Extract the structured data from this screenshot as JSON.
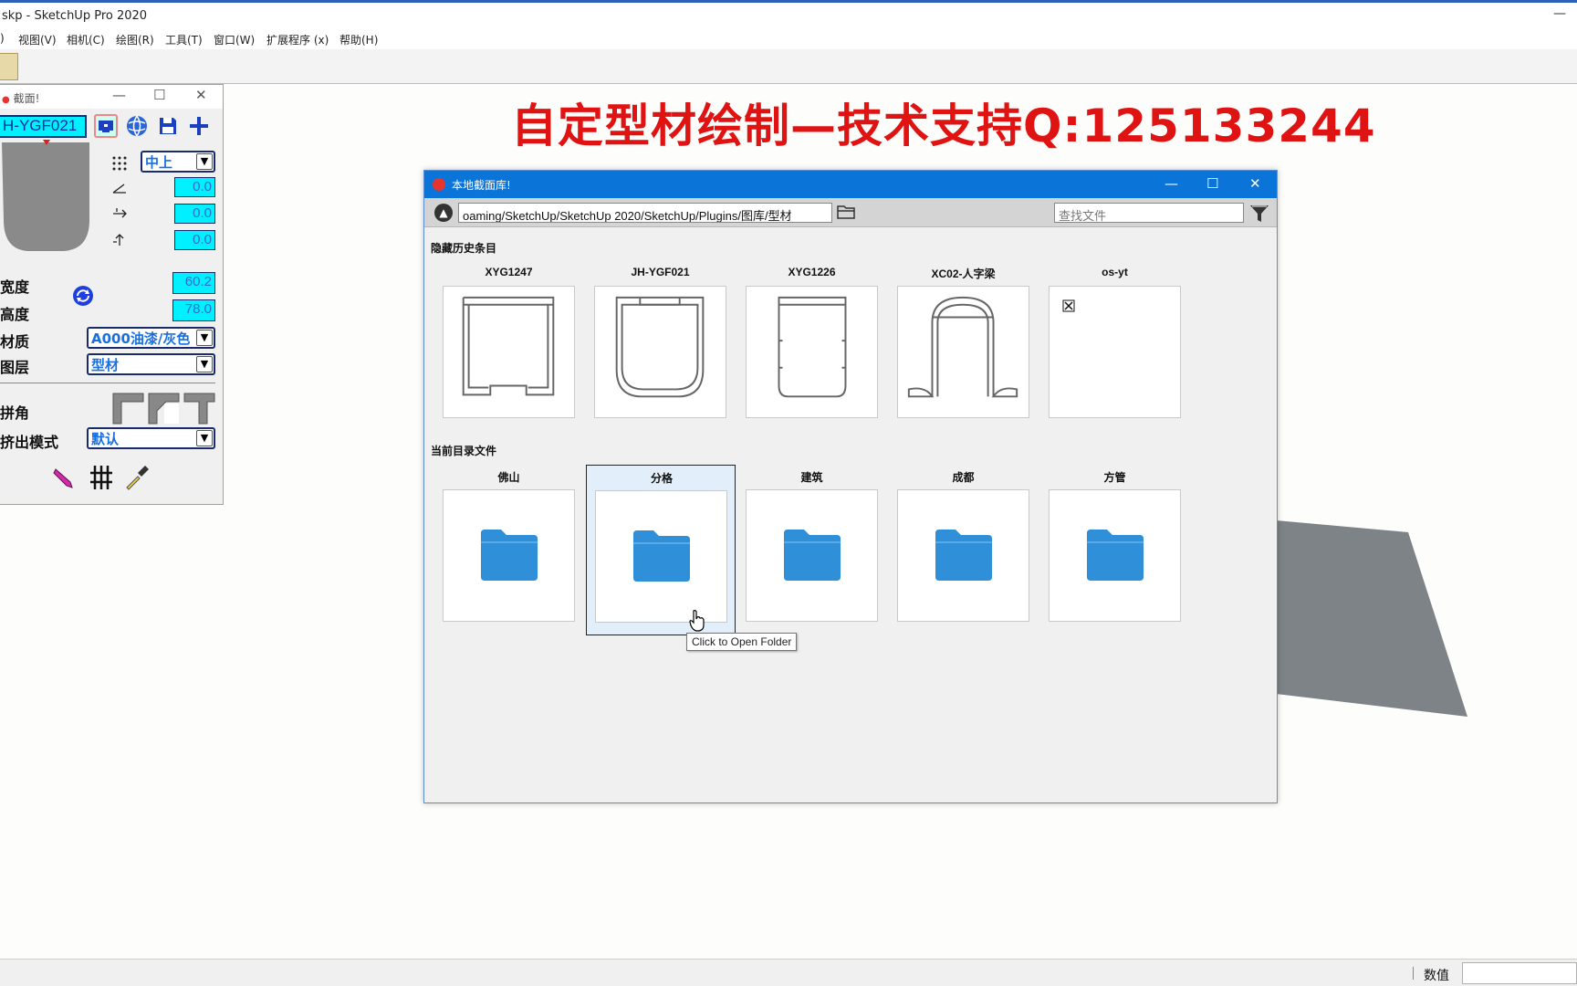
{
  "window": {
    "title": "skp - SketchUp Pro 2020",
    "minimize_glyph": "—"
  },
  "menu": {
    "items": [
      ")",
      "视图(V)",
      "相机(C)",
      "绘图(R)",
      "工具(T)",
      "窗口(W)",
      "扩展程序 (x)",
      "帮助(H)"
    ]
  },
  "headline": "自定型材绘制—技术支持Q:125133244",
  "panel": {
    "title": "截面!",
    "profile_name": "H-YGF021",
    "anchor_value": "中上",
    "angle_value": "0.0",
    "offset_x_value": "0.0",
    "offset_y_value": "0.0",
    "width_label": "宽度",
    "width_value": "60.2",
    "height_label": "高度",
    "height_value": "78.0",
    "material_label": "材质",
    "material_value": "A000油漆/灰色",
    "layer_label": "图层",
    "layer_value": "型材",
    "corner_label": "拼角",
    "extrude_label": "挤出模式",
    "extrude_value": "默认"
  },
  "dialog": {
    "title": "本地截面库!",
    "path": "oaming/SketchUp/SketchUp 2020/SketchUp/Plugins/图库/型材",
    "search_placeholder": "查找文件",
    "history_label": "隐藏历史条目",
    "history": [
      {
        "name": "XYG1247"
      },
      {
        "name": "JH-YGF021"
      },
      {
        "name": "XYG1226"
      },
      {
        "name": "XC02-人字梁"
      },
      {
        "name": "os-yt"
      }
    ],
    "files_label": "当前目录文件",
    "folders": [
      {
        "name": "佛山"
      },
      {
        "name": "分格"
      },
      {
        "name": "建筑"
      },
      {
        "name": "成都"
      },
      {
        "name": "方管"
      }
    ],
    "tooltip": "Click to Open Folder"
  },
  "status": {
    "value_label": "数值"
  },
  "colors": {
    "headline": "#e01313",
    "dialog_title": "#0a74d8",
    "cyan_field": "#00f0ff",
    "folder": "#2f8fd8",
    "slab": "#7d8386"
  },
  "icons": [
    "monitor-icon",
    "globe-icon",
    "save-icon",
    "plus-icon",
    "grid-icon",
    "angle-icon",
    "offset-x-icon",
    "offset-y-icon",
    "refresh-icon",
    "pencil-icon",
    "hatch-icon",
    "eyedropper-icon",
    "up-arrow-icon",
    "folder-icon",
    "filter-icon",
    "cursor-hand-icon"
  ]
}
